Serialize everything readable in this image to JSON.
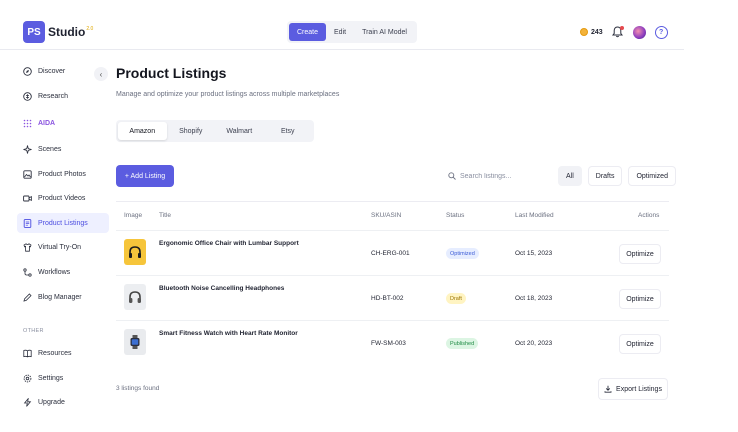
{
  "brand": {
    "logo_initials": "PS",
    "name": "Studio",
    "version": "2.0"
  },
  "header": {
    "modes": [
      "Create",
      "Edit",
      "Train AI Model"
    ],
    "active_mode": "Create",
    "credits": "243"
  },
  "sidebar": {
    "items": [
      {
        "label": "Discover",
        "icon": "compass-icon"
      },
      {
        "label": "Research",
        "icon": "research-icon"
      },
      {
        "label": "AIDA",
        "icon": "grid-dots-icon"
      },
      {
        "label": "Scenes",
        "icon": "sparkle-icon"
      },
      {
        "label": "Product Photos",
        "icon": "image-icon"
      },
      {
        "label": "Product Videos",
        "icon": "video-icon"
      },
      {
        "label": "Product Listings",
        "icon": "document-icon"
      },
      {
        "label": "Virtual Try-On",
        "icon": "shirt-icon"
      },
      {
        "label": "Workflows",
        "icon": "workflow-icon"
      },
      {
        "label": "Blog Manager",
        "icon": "pen-icon"
      }
    ],
    "other_label": "OTHER",
    "other_items": [
      {
        "label": "Resources",
        "icon": "book-icon"
      },
      {
        "label": "Settings",
        "icon": "gear-icon"
      },
      {
        "label": "Upgrade",
        "icon": "lightning-icon"
      }
    ]
  },
  "main": {
    "title": "Product Listings",
    "subtitle": "Manage and optimize your product listings across multiple marketplaces",
    "marketplaces": [
      "Amazon",
      "Shopify",
      "Walmart",
      "Etsy"
    ],
    "active_marketplace": "Amazon",
    "add_button": "+ Add Listing",
    "search_placeholder": "Search listings...",
    "filters": [
      "All",
      "Drafts",
      "Optimized"
    ],
    "table": {
      "headers": [
        "Image",
        "Title",
        "SKU/ASIN",
        "Status",
        "Last Modified",
        "Actions"
      ],
      "rows": [
        {
          "title": "Ergonomic Office Chair with Lumbar Support",
          "sku": "CH-ERG-001",
          "status": "Optimized",
          "modified": "Oct 15, 2023",
          "action": "Optimize",
          "thumb": "headphones-yellow"
        },
        {
          "title": "Bluetooth Noise Cancelling Headphones",
          "sku": "HD-BT-002",
          "status": "Draft",
          "modified": "Oct 18, 2023",
          "action": "Optimize",
          "thumb": "headphones-gray"
        },
        {
          "title": "Smart Fitness Watch with Heart Rate Monitor",
          "sku": "FW-SM-003",
          "status": "Published",
          "modified": "Oct 20, 2023",
          "action": "Optimize",
          "thumb": "smartwatch"
        }
      ]
    },
    "footer_count": "3 listings found",
    "export_button": "Export Listings"
  },
  "colors": {
    "accent": "#5b5ce0",
    "optimized_bg": "#e6edff",
    "optimized_fg": "#3b5bd6",
    "draft_bg": "#fff4c2",
    "draft_fg": "#9a7300",
    "published_bg": "#dcf5e3",
    "published_fg": "#1f8a44"
  }
}
